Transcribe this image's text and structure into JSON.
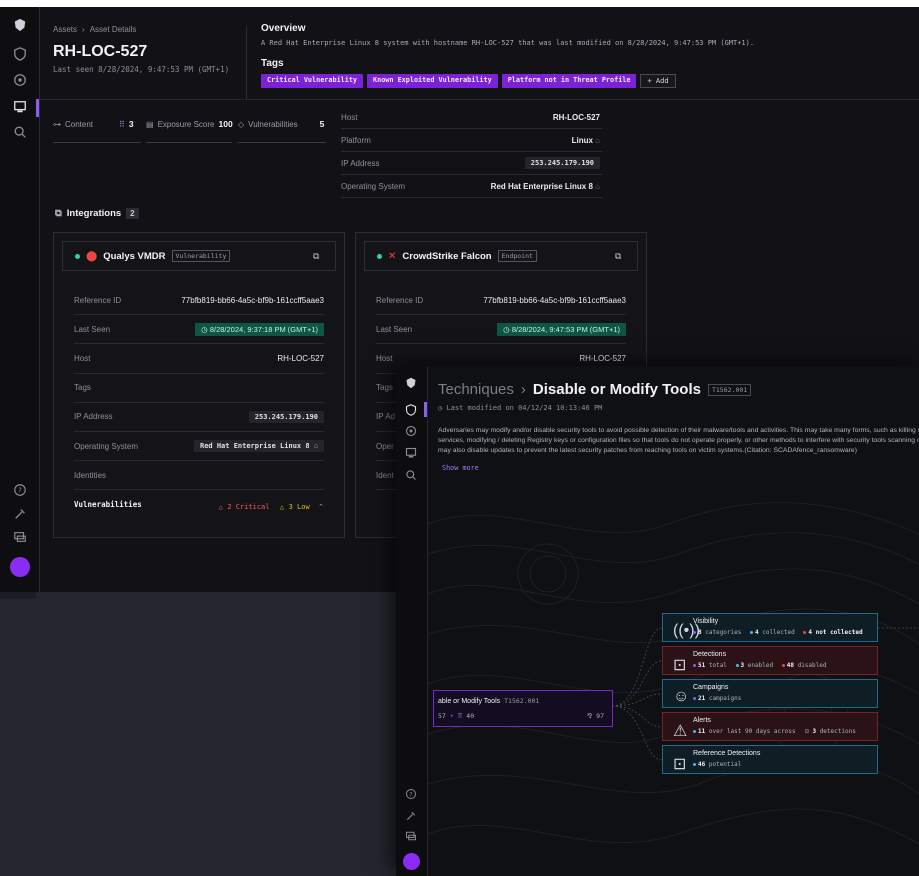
{
  "asset": {
    "breadcrumb": [
      "Assets",
      "Asset Details"
    ],
    "breadcrumb_sep": "›",
    "name": "RH-LOC-527",
    "last_seen": "Last seen 8/28/2024, 9:47:53 PM (GMT+1)",
    "overview_title": "Overview",
    "overview_desc": "A Red Hat Enterprise Linux 8 system with hostname RH-LOC-527 that was last modified on 8/28/2024, 9:47:53 PM (GMT+1).",
    "tags_title": "Tags",
    "tags": [
      "Critical Vulnerability",
      "Known Exploited Vulnerability",
      "Platform not in Threat Profile"
    ],
    "add_tag_label": "+ Add",
    "stats": [
      {
        "label": "Content",
        "value": "3"
      },
      {
        "label": "Exposure Score",
        "value": "100"
      },
      {
        "label": "Vulnerabilities",
        "value": "5"
      }
    ],
    "info": [
      {
        "key": "Host",
        "value": "RH-LOC-527"
      },
      {
        "key": "Platform",
        "value": "Linux"
      },
      {
        "key": "IP Address",
        "value": "253.245.179.190"
      },
      {
        "key": "Operating System",
        "value": "Red Hat Enterprise Linux 8"
      }
    ],
    "integrations_title": "Integrations",
    "integrations_count": "2",
    "integrations": [
      {
        "name": "Qualys VMDR",
        "type": "Vulnerability",
        "reference_id": "77bfb819-bb66-4a5c-bf9b-161ccff5aae3",
        "last_seen": "8/28/2024, 9:37:18 PM (GMT+1)",
        "host": "RH-LOC-527",
        "ip": "253.245.179.190",
        "os": "Red Hat Enterprise Linux 8",
        "vuln_critical": "2 Critical",
        "vuln_low": "3 Low"
      },
      {
        "name": "CrowdStrike Falcon",
        "type": "Endpoint",
        "reference_id": "77bfb819-bb66-4a5c-bf9b-161ccff5aae3",
        "last_seen": "8/28/2024, 9:47:53 PM (GMT+1)",
        "host": "RH-LOC-527"
      }
    ],
    "row_labels": {
      "reference_id": "Reference ID",
      "last_seen": "Last Seen",
      "host": "Host",
      "tags": "Tags",
      "ip": "IP Address",
      "os": "Operating System",
      "identities": "Identities",
      "vulnerabilities": "Vulnerabilities"
    },
    "truncated_labels": {
      "tags": "Tags",
      "ip": "IP Ad",
      "os": "Oper",
      "identities": "Ident"
    }
  },
  "technique": {
    "crumb": "Techniques",
    "crumb_sep": "›",
    "name": "Disable or Modify Tools",
    "id": "T1562.001",
    "modified": "Last modified on 04/12/24 10:13:46 PM",
    "description": "Adversaries may modify and/or disable security tools to avoid possible detection of their malware/tools and activities. This may take many forms, such as killing security software processes or services, modifying / deleting Registry keys or configuration files so that tools do not operate properly, or other methods to interfere with security tools scanning or reporting information. Adversaries may also disable updates to prevent the latest security patches from reaching tools on victim systems.(Citation: SCADAfence_ransomware)",
    "show_more": "Show more",
    "node": {
      "title": "able or Modify Tools",
      "id": "T1562.001",
      "left_stat": "57",
      "mid_stat": "40",
      "right_stat": "97"
    },
    "branches": [
      {
        "title": "Visibility",
        "parts": [
          {
            "n": "8",
            "t": "categories",
            "c": "#8b5cf6"
          },
          {
            "n": "4",
            "t": "collected",
            "c": "#38bdf8"
          },
          {
            "n": "4 not collected",
            "t": "",
            "c": "#ef4444"
          }
        ],
        "style": "blue"
      },
      {
        "title": "Detections",
        "parts": [
          {
            "n": "51",
            "t": "total",
            "c": "#8b5cf6"
          },
          {
            "n": "3",
            "t": "enabled",
            "c": "#38bdf8"
          },
          {
            "n": "48",
            "t": "disabled",
            "c": "#ef4444"
          }
        ],
        "style": "red"
      },
      {
        "title": "Campaigns",
        "parts": [
          {
            "n": "21",
            "t": "campaigns",
            "c": "#8b5cf6"
          }
        ],
        "style": "blue"
      },
      {
        "title": "Alerts",
        "parts": [
          {
            "n": "11",
            "t": "over last 90 days across",
            "c": "#38bdf8"
          },
          {
            "n": "3",
            "t": "detections",
            "c": ""
          }
        ],
        "style": "red"
      },
      {
        "title": "Reference Detections",
        "parts": [
          {
            "n": "46",
            "t": "potential",
            "c": "#38bdf8"
          }
        ],
        "style": "blue"
      }
    ]
  },
  "colors": {
    "accent": "#8b2cf5",
    "tag_bg": "#7b22d6",
    "green_chip": "#0e5546"
  }
}
